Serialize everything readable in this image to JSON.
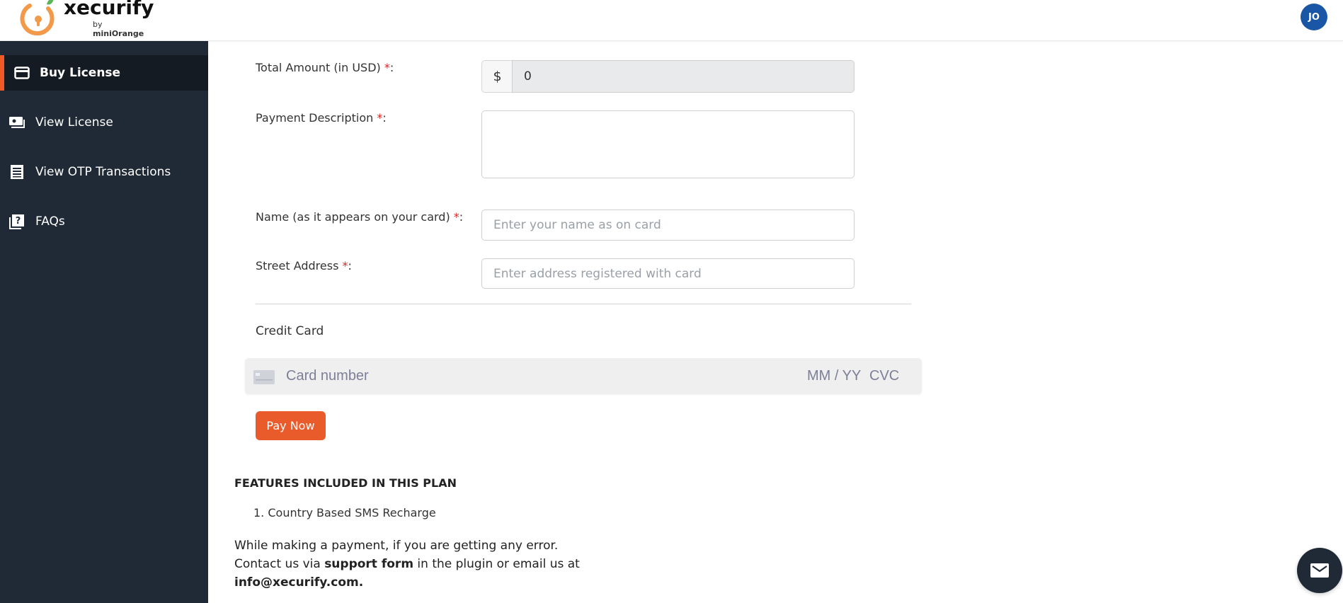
{
  "header": {
    "brand": "xecurify",
    "by_prefix": "by ",
    "by_brand": "miniOrange",
    "avatar_initials": "JO",
    "accent_color": "#f15a24",
    "avatar_color": "#1a56a6"
  },
  "sidebar": {
    "items": [
      {
        "label": "Buy License",
        "icon": "credit-card-icon",
        "active": true
      },
      {
        "label": "View License",
        "icon": "license-icon",
        "active": false
      },
      {
        "label": "View OTP Transactions",
        "icon": "receipt-icon",
        "active": false
      },
      {
        "label": "FAQs",
        "icon": "question-icon",
        "active": false
      }
    ]
  },
  "form": {
    "total_amount": {
      "label": "Total Amount (in USD) ",
      "required_mark": "*",
      "suffix": ":",
      "currency_symbol": "$",
      "value": "0"
    },
    "payment_description": {
      "label": "Payment Description ",
      "required_mark": "*",
      "suffix": ":",
      "value": ""
    },
    "card_name": {
      "label": "Name (as it appears on your card) ",
      "required_mark": "*",
      "suffix": ":",
      "placeholder": "Enter your name as on card",
      "value": ""
    },
    "street_address": {
      "label": "Street Address ",
      "required_mark": "*",
      "suffix": ":",
      "placeholder": "Enter address registered with card",
      "value": ""
    },
    "credit_card": {
      "section_label": "Credit Card",
      "number_placeholder": "Card number",
      "expiry_placeholder": "MM / YY",
      "cvc_placeholder": "CVC"
    },
    "pay_button": "Pay Now",
    "pay_button_color": "#e95b2a"
  },
  "features": {
    "title": "FEATURES INCLUDED IN THIS PLAN",
    "items": [
      "1. Country Based SMS Recharge"
    ]
  },
  "help": {
    "line1": "While making a payment, if you are getting any error.",
    "line2_prefix": "Contact us via ",
    "line2_bold": "support form",
    "line2_suffix": " in the plugin or email us at",
    "email": "info@xecurify.com."
  }
}
